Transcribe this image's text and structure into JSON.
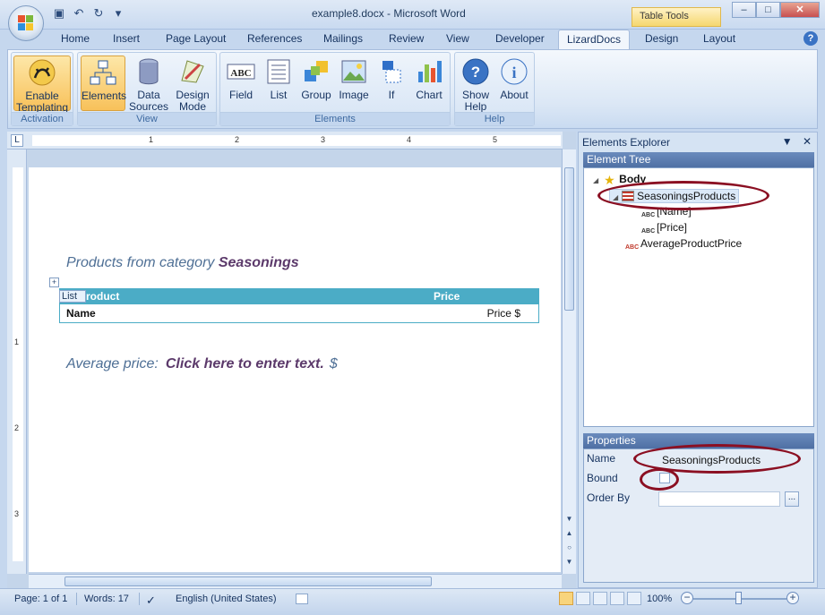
{
  "window": {
    "title": "example8.docx - Microsoft Word",
    "context_tab": "Table Tools",
    "controls": [
      "–",
      "□",
      "✕"
    ]
  },
  "ribbon_tabs": [
    "Home",
    "Insert",
    "Page Layout",
    "References",
    "Mailings",
    "Review",
    "View",
    "Developer",
    "LizardDocs",
    "Design",
    "Layout"
  ],
  "active_tab": "LizardDocs",
  "ribbon": {
    "activation": {
      "label": "Activation",
      "button": "Enable Templating"
    },
    "view": {
      "label": "View",
      "buttons": [
        "Elements",
        "Data Sources",
        "Design Mode"
      ]
    },
    "elements": {
      "label": "Elements",
      "buttons": [
        "Field",
        "List",
        "Group",
        "Image",
        "If",
        "Chart"
      ]
    },
    "help": {
      "label": "Help",
      "buttons": [
        "Show Help",
        "About"
      ]
    }
  },
  "ruler": {
    "numbers": [
      "1",
      "2",
      "3",
      "4",
      "5"
    ]
  },
  "document": {
    "heading_prefix": "Products from  category",
    "heading_value": "Seasonings",
    "list_tag": "List",
    "table": {
      "headers": [
        "Product",
        "Price"
      ],
      "row": [
        "Name",
        "Price $"
      ]
    },
    "avg_label": "Average price:",
    "avg_placeholder": "Click here to enter text.",
    "avg_suffix": "$"
  },
  "explorer": {
    "title": "Elements Explorer",
    "tree_header": "Element Tree",
    "nodes": [
      "Body",
      "SeasoningsProducts",
      "[Name]",
      "[Price]",
      "AverageProductPrice"
    ],
    "properties_header": "Properties",
    "props": {
      "name_label": "Name",
      "name_value": "SeasoningsProducts",
      "bound_label": "Bound",
      "orderby_label": "Order By",
      "orderby_value": ""
    }
  },
  "status": {
    "page": "Page: 1 of 1",
    "words": "Words: 17",
    "language": "English (United States)",
    "zoom": "100%"
  },
  "colors": {
    "accent": "#4bacc6",
    "highlight_ring": "#8b0f22",
    "selected_button": "#f8c15a"
  }
}
